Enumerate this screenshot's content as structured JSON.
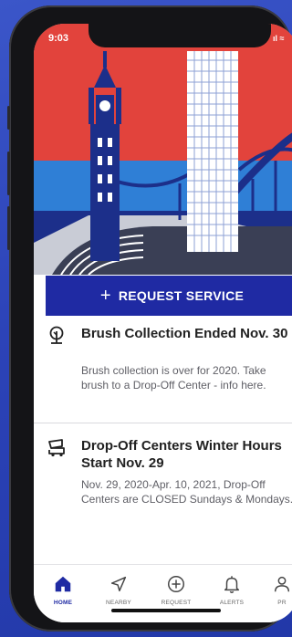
{
  "status": {
    "time": "9:03",
    "indicators": "ıl ≈"
  },
  "hero": {
    "icon": "city-skyline-illustration"
  },
  "cta": {
    "icon": "plus-icon",
    "label": "REQUEST SERVICE"
  },
  "alerts": [
    {
      "icon": "tree-icon",
      "title": "Brush Collection Ended Nov. 30",
      "body": "Brush collection is over for 2020. Take brush to a Drop-Off Center - info here."
    },
    {
      "icon": "dump-truck-icon",
      "title": "Drop-Off Centers Winter Hours Start Nov. 29",
      "body": "Nov. 29, 2020-Apr. 10, 2021, Drop-Off Centers are CLOSED Sundays & Mondays."
    }
  ],
  "tabs": [
    {
      "label": "HOME",
      "icon": "home-icon",
      "active": true
    },
    {
      "label": "NEARBY",
      "icon": "navigation-arrow-icon"
    },
    {
      "label": "REQUEST",
      "icon": "plus-circle-icon"
    },
    {
      "label": "ALERTS",
      "icon": "bell-icon"
    },
    {
      "label": "PR",
      "icon": "profile-icon"
    }
  ],
  "colors": {
    "brand_blue": "#1f2aa3",
    "hero_red": "#e2433c",
    "sky_blue": "#2f7fd6"
  }
}
